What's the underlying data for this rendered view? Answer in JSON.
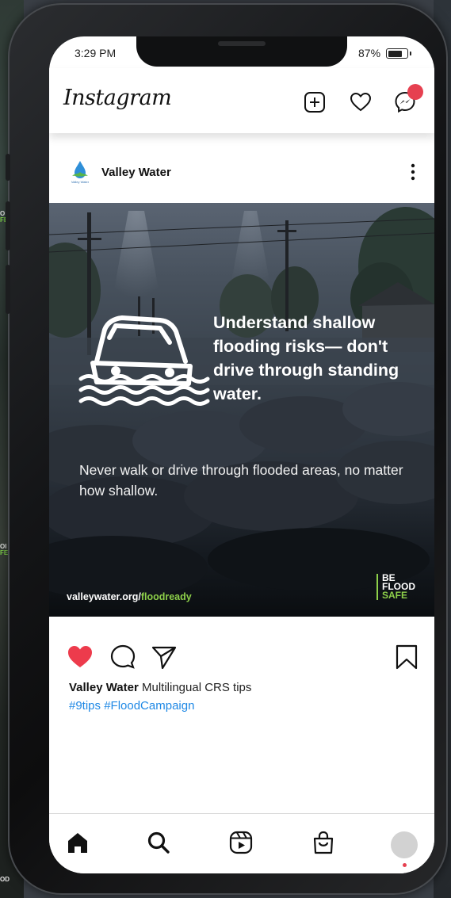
{
  "status_bar": {
    "time": "3:29 PM",
    "battery": "87%",
    "battery_level": 0.87
  },
  "header": {
    "logo": "Instagram",
    "icons": [
      "new-post-icon",
      "heart-icon",
      "messenger-icon"
    ],
    "notification_color": "#e64050"
  },
  "post": {
    "account_name": "Valley Water",
    "logo_text": "Valley Water",
    "image": {
      "headline": "Understand shallow flooding risks— don't drive through standing water.",
      "subtext": "Never walk or drive through flooded areas, no matter how shallow.",
      "url_prefix": "valleywater.org/",
      "url_highlight": "floodready",
      "badge_line1": "BE",
      "badge_line2": "FLOOD",
      "badge_line3": "SAFE"
    },
    "liked": true,
    "caption_account": "Valley Water",
    "caption_text": " Multilingual CRS tips",
    "hashtags": "#9tips #FloodCampaign"
  },
  "bottom_nav": [
    "home-icon",
    "search-icon",
    "reels-icon",
    "shop-icon",
    "profile-avatar"
  ],
  "colors": {
    "like": "#ed3b4c",
    "hashtag": "#1e88e5",
    "accent_green": "#8ed04a"
  },
  "background_side": {
    "top_line1": "O",
    "top_line2": "FE",
    "mid_line1": "OI",
    "mid_line2": "FE",
    "bottom": "OD"
  }
}
